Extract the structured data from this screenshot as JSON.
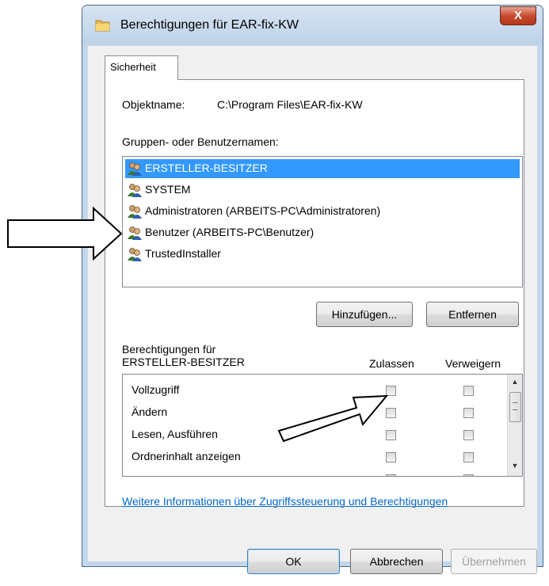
{
  "window": {
    "title": "Berechtigungen für EAR-fix-KW",
    "close_label": "X"
  },
  "tab": {
    "label": "Sicherheit"
  },
  "object": {
    "label": "Objektname:",
    "value": "C:\\Program Files\\EAR-fix-KW"
  },
  "groups": {
    "label": "Gruppen- oder Benutzernamen:",
    "items": [
      {
        "name": "ERSTELLER-BESITZER",
        "selected": true
      },
      {
        "name": "SYSTEM",
        "selected": false
      },
      {
        "name": "Administratoren (ARBEITS-PC\\Administratoren)",
        "selected": false
      },
      {
        "name": "Benutzer (ARBEITS-PC\\Benutzer)",
        "selected": false
      },
      {
        "name": "TrustedInstaller",
        "selected": false
      }
    ]
  },
  "buttons": {
    "add": "Hinzufügen...",
    "remove": "Entfernen",
    "ok": "OK",
    "cancel": "Abbrechen",
    "apply": "Übernehmen"
  },
  "permissions": {
    "label_line1": "Berechtigungen für",
    "label_line2": "ERSTELLER-BESITZER",
    "col_allow": "Zulassen",
    "col_deny": "Verweigern",
    "rows": [
      {
        "name": "Vollzugriff",
        "allow": false,
        "deny": false
      },
      {
        "name": "Ändern",
        "allow": false,
        "deny": false
      },
      {
        "name": "Lesen, Ausführen",
        "allow": false,
        "deny": false
      },
      {
        "name": "Ordnerinhalt anzeigen",
        "allow": false,
        "deny": false
      },
      {
        "name": "",
        "allow": false,
        "deny": false
      }
    ]
  },
  "link": {
    "text": "Weitere Informationen über Zugriffssteuerung und Berechtigungen"
  },
  "colors": {
    "selection": "#3399ff",
    "link": "#0066cc",
    "frame": "#c2d6ec"
  }
}
